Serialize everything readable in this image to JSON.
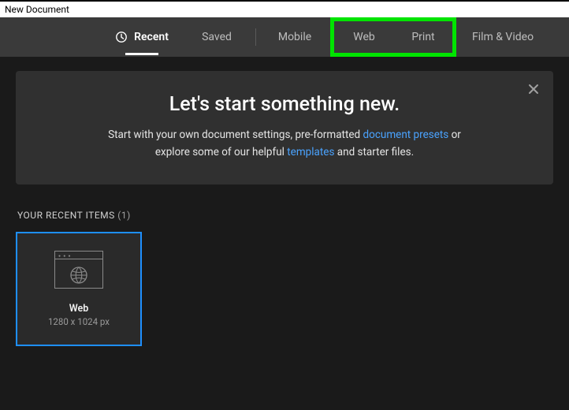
{
  "window": {
    "title": "New Document"
  },
  "tabs": {
    "recent": "Recent",
    "saved": "Saved",
    "mobile": "Mobile",
    "web": "Web",
    "print": "Print",
    "film": "Film & Video"
  },
  "banner": {
    "title": "Let's start something new.",
    "line1_a": "Start with your own document settings, pre-formatted ",
    "link1": "document presets",
    "line1_b": " or",
    "line2_a": "explore some of our helpful ",
    "link2": "templates",
    "line2_b": " and starter files."
  },
  "section": {
    "label": "YOUR RECENT ITEMS",
    "count": "(1)"
  },
  "items": [
    {
      "title": "Web",
      "subtitle": "1280 x 1024 px"
    }
  ]
}
